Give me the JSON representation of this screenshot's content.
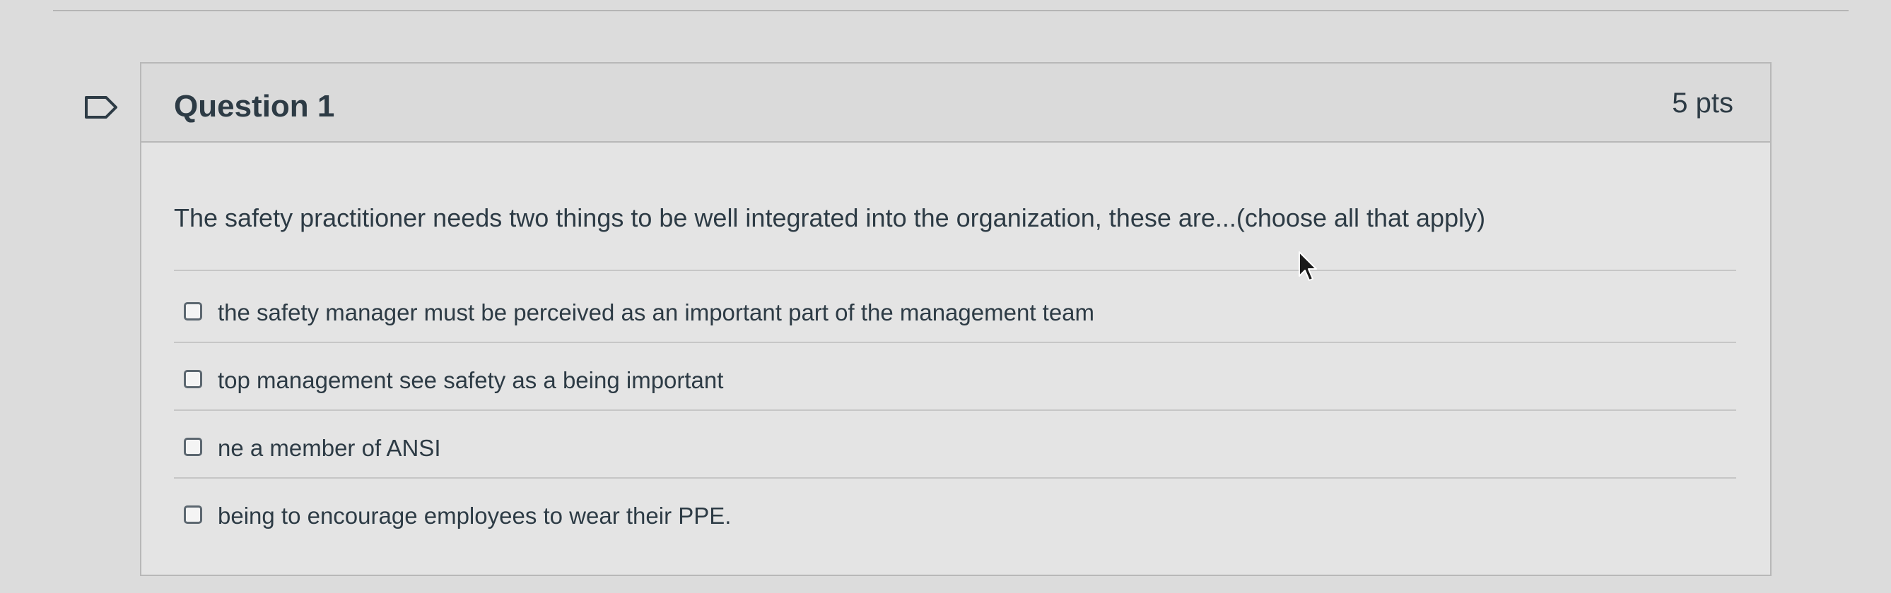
{
  "question": {
    "title": "Question 1",
    "points": "5 pts",
    "prompt": "The safety practitioner needs two things to be well integrated into the organization,  these are...(choose all that apply)",
    "answers": [
      {
        "label": "the safety manager must be perceived as an important part of the management team",
        "checked": false
      },
      {
        "label": "top management see safety as a being important",
        "checked": false
      },
      {
        "label": "ne a member of ANSI",
        "checked": false
      },
      {
        "label": "being to encourage employees to wear their PPE.",
        "checked": false
      }
    ]
  },
  "icons": {
    "flag": "flag-question-icon",
    "cursor": "mouse-pointer-icon"
  },
  "colors": {
    "text": "#2d3b45",
    "border": "#b8b8b8",
    "background": "#dcdcdc"
  }
}
